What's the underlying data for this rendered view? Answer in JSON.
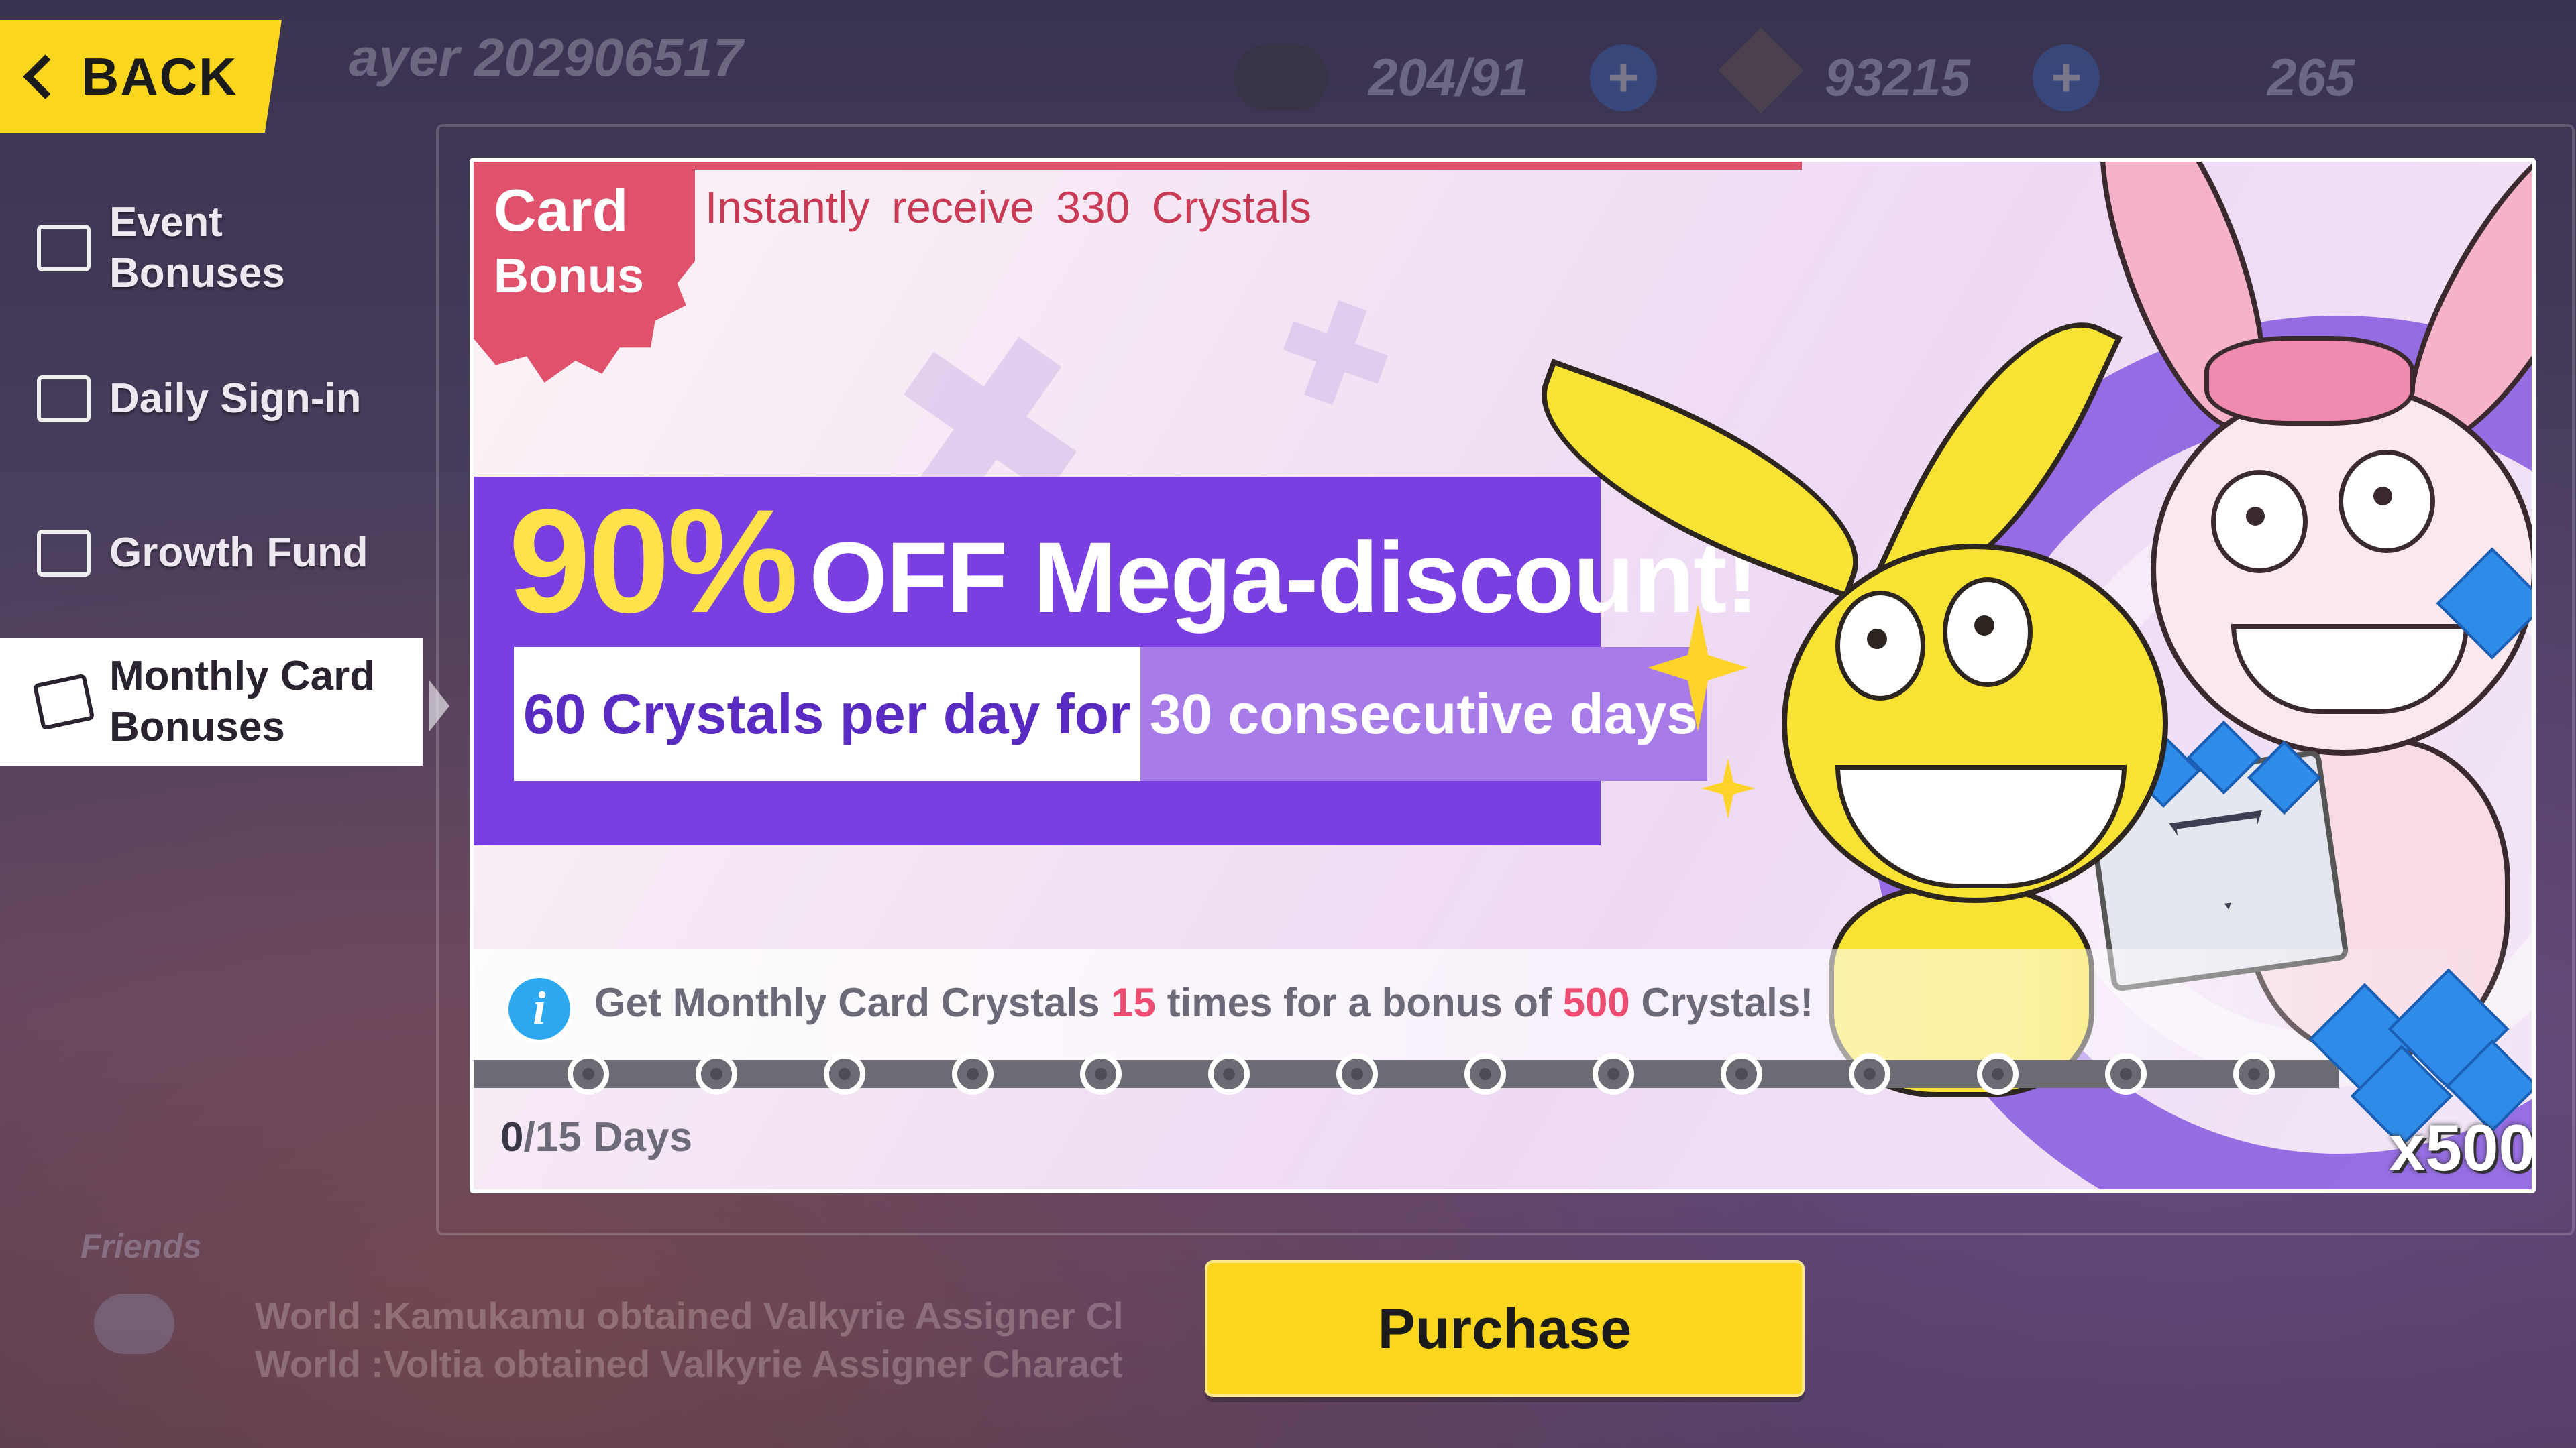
{
  "background": {
    "player_label": "ayer 202906517",
    "resources": [
      {
        "name": "stamina",
        "value": "204/91"
      },
      {
        "name": "coins",
        "value": "93215"
      },
      {
        "name": "crystals",
        "value": "265"
      }
    ],
    "friends_label": "Friends",
    "chat_lines": [
      "World :Kamukamu obtained Valkyrie Assigner Cl",
      "World :Voltia obtained Valkyrie Assigner Charact"
    ]
  },
  "back_button": {
    "label": "BACK"
  },
  "sidebar": {
    "items": [
      {
        "label_line1": "Event",
        "label_line2": "Bonuses",
        "icon": "gift-box-icon",
        "active": false
      },
      {
        "label": "Daily Sign-in",
        "icon": "calendar-check-icon",
        "active": false
      },
      {
        "label": "Growth Fund",
        "icon": "fund-card-icon",
        "active": false
      },
      {
        "label_line1": "Monthly Card",
        "label_line2": "Bonuses",
        "icon": "card-gem-icon",
        "active": true
      }
    ]
  },
  "card": {
    "badge_line1": "Card",
    "badge_line2": "Bonus",
    "instant_text": "Instantly receive 330 Crystals",
    "discount_pct": "90%",
    "discount_text": "OFF Mega-discount!",
    "sub_a": "60 Crystals per day for",
    "sub_b": "30 consecutive days",
    "info": {
      "prefix": "Get Monthly Card Crystals ",
      "times": "15",
      "middle": " times for a bonus of ",
      "bonus": "500",
      "suffix": " Crystals!"
    },
    "progress": {
      "current": "0",
      "total_label": "/15 Days",
      "value": 0,
      "max": 15
    },
    "reward_qty": "x500"
  },
  "purchase_button": {
    "label": "Purchase"
  },
  "colors": {
    "accent_yellow": "#fbd61e",
    "purple": "#7a3fe0",
    "pink": "#e0516b",
    "info_blue": "#2ba8ef"
  }
}
